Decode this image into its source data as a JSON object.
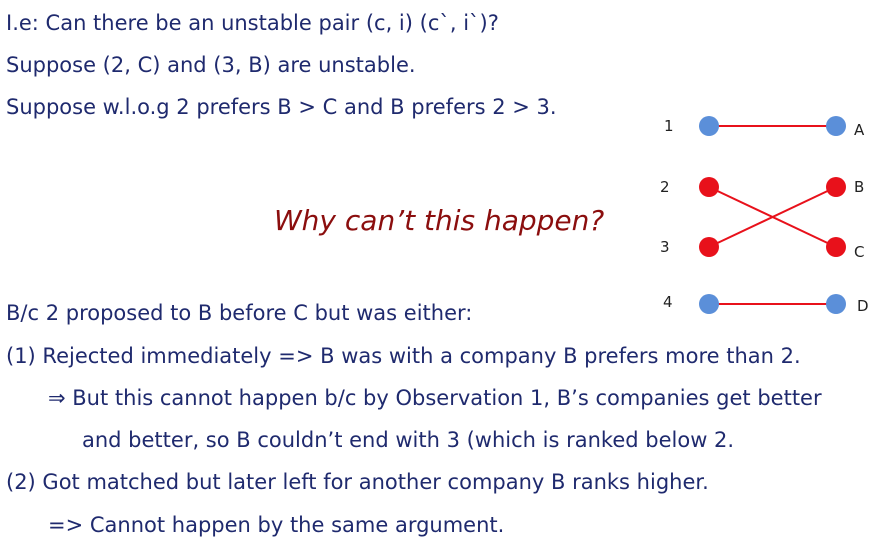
{
  "text": {
    "line1": "I.e: Can there be an unstable pair (c, i) (c`, i`)?",
    "line2": "Suppose (2, C) and (3, B) are unstable.",
    "line3": "Suppose w.l.o.g 2 prefers B > C and B prefers 2 > 3.",
    "question": "Why can’t this happen?",
    "line4": "B/c 2 proposed to B before C but was either:",
    "line5": "(1)  Rejected immediately => B was with a company B prefers more than 2.",
    "line6": "⇒ But this cannot happen b/c by Observation 1, B’s companies get better",
    "line7": "and better, so B couldn’t end with 3 (which is ranked below 2.",
    "line8": "(2) Got matched but later left for another company B ranks higher.",
    "line9": "=> Cannot happen by the same argument."
  },
  "diagram": {
    "left_nodes": [
      "1",
      "2",
      "3",
      "4"
    ],
    "right_nodes": [
      "A",
      "B",
      "C",
      "D"
    ],
    "colors": {
      "blue_node": "#5b8fd9",
      "red_node": "#e8111b",
      "edge": "#e8111b"
    }
  }
}
